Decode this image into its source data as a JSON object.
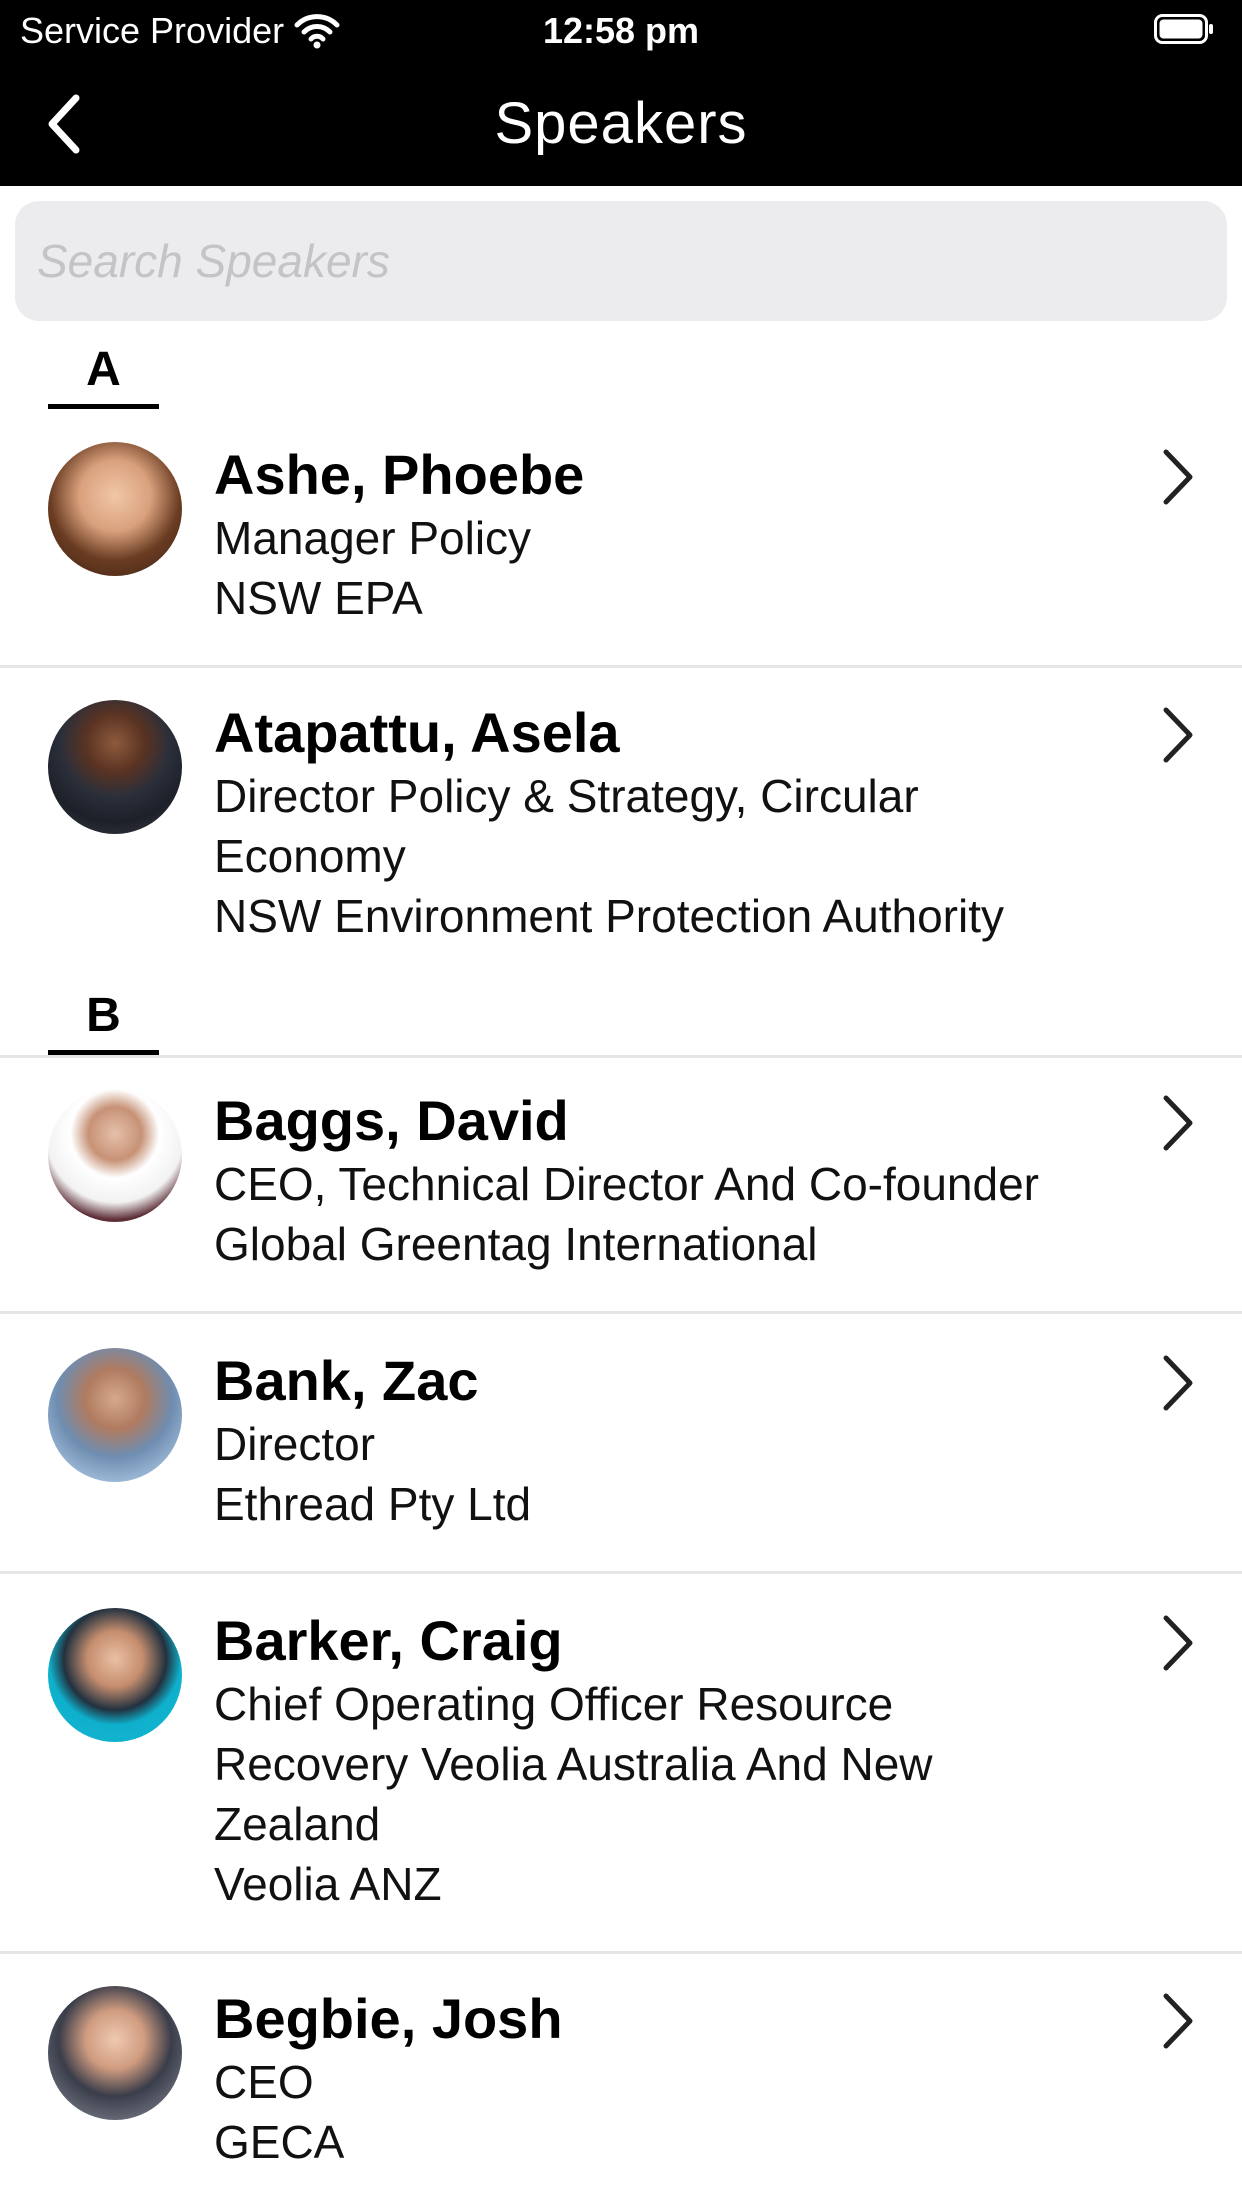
{
  "status_bar": {
    "carrier": "Service Provider",
    "time": "12:58 pm",
    "wifi_icon": "wifi-icon",
    "battery_icon": "battery-icon"
  },
  "nav": {
    "title": "Speakers",
    "back_icon": "chevron-left-icon"
  },
  "search": {
    "placeholder": "Search Speakers",
    "value": ""
  },
  "sections": [
    {
      "letter": "A"
    },
    {
      "letter": "B"
    }
  ],
  "speakers": [
    {
      "name": "Ashe, Phoebe",
      "title_lines": [
        "Manager Policy"
      ],
      "organization": "NSW EPA"
    },
    {
      "name": "Atapattu, Asela",
      "title_lines": [
        "Director Policy & Strategy, Circular",
        "Economy"
      ],
      "organization": "NSW Environment Protection Authority"
    },
    {
      "name": "Baggs, David",
      "title_lines": [
        "CEO, Technical Director And Co-founder"
      ],
      "organization": "Global Greentag International"
    },
    {
      "name": "Bank, Zac",
      "title_lines": [
        "Director"
      ],
      "organization": "Ethread Pty Ltd"
    },
    {
      "name": "Barker, Craig",
      "title_lines": [
        "Chief Operating Officer Resource",
        "Recovery Veolia Australia And New",
        "Zealand"
      ],
      "organization": "Veolia ANZ"
    },
    {
      "name": "Begbie, Josh",
      "title_lines": [
        "CEO"
      ],
      "organization": "GECA"
    }
  ],
  "colors": {
    "header_bg": "#000000",
    "header_text": "#ffffff",
    "search_bg": "#ececef",
    "placeholder": "#c4c4c8",
    "divider": "#e6e6e6"
  }
}
